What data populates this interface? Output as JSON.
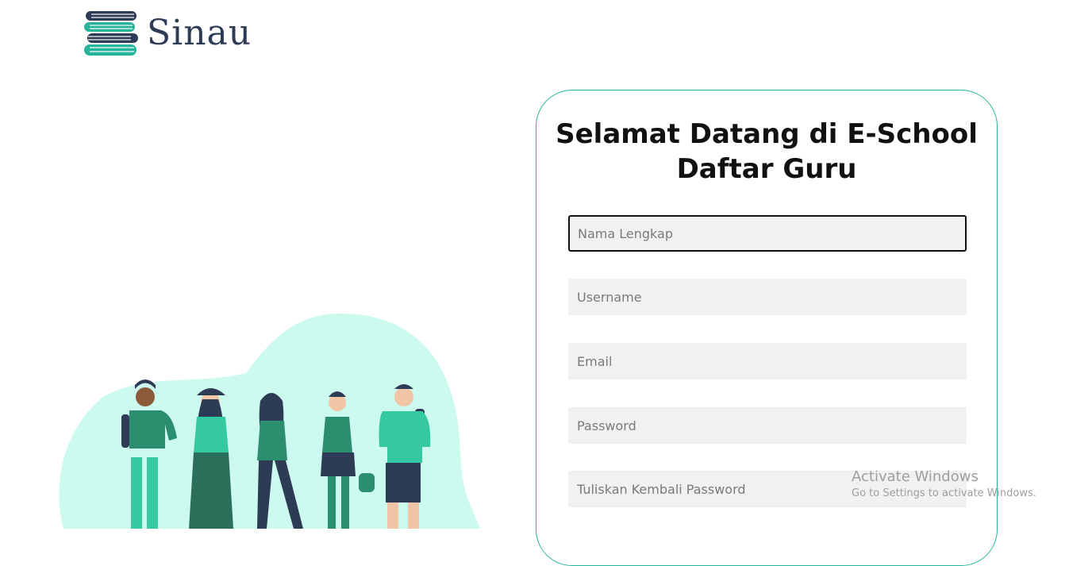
{
  "brand": {
    "name": "Sinau",
    "logo_icon": "stacked-books-icon"
  },
  "form": {
    "title_line1": "Selamat Datang di E-School",
    "title_line2": "Daftar Guru",
    "fields": {
      "full_name": {
        "placeholder": "Nama Lengkap",
        "value": ""
      },
      "username": {
        "placeholder": "Username",
        "value": ""
      },
      "email": {
        "placeholder": "Email",
        "value": ""
      },
      "password": {
        "placeholder": "Password",
        "value": ""
      },
      "confirm_password": {
        "placeholder": "Tuliskan Kembali Password",
        "value": ""
      }
    }
  },
  "watermark": {
    "line1": "Activate Windows",
    "line2": "Go to Settings to activate Windows."
  },
  "colors": {
    "accent": "#26b59a",
    "blob": "#ccfaee",
    "navy": "#2d3b55",
    "field_bg": "#f1f1f1"
  }
}
